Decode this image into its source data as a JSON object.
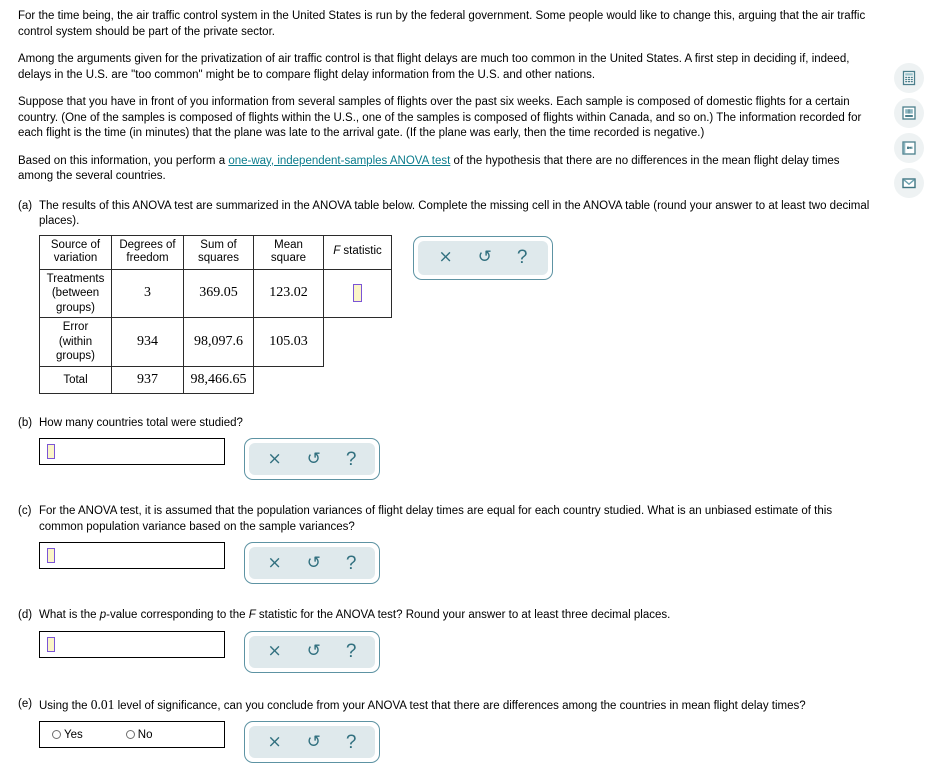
{
  "intro": {
    "p1": "For the time being, the air traffic control system in the United States is run by the federal government. Some people would like to change this, arguing that the air traffic control system should be part of the private sector.",
    "p2": "Among the arguments given for the privatization of air traffic control is that flight delays are much too common in the United States. A first step in deciding if, indeed, delays in the U.S. are \"too common\" might be to compare flight delay information from the U.S. and other nations.",
    "p3": "Suppose that you have in front of you information from several samples of flights over the past six weeks. Each sample is composed of domestic flights for a certain country. (One of the samples is composed of flights within the U.S., one of the samples is composed of flights within Canada, and so on.) The information recorded for each flight is the time (in minutes) that the plane was late to the arrival gate. (If the plane was early, then the time recorded is negative.)",
    "p4_before": "Based on this information, you perform a ",
    "p4_link": "one-way, independent-samples ANOVA test",
    "p4_after": " of the hypothesis that there are no differences in the mean flight delay times among the several countries."
  },
  "parts": {
    "a": {
      "label": "(a)",
      "text": "The results of this ANOVA test are summarized in the ANOVA table below. Complete the missing cell in the ANOVA table (round your answer to at least two decimal places)."
    },
    "b": {
      "label": "(b)",
      "text": "How many countries total were studied?",
      "input_value": ""
    },
    "c": {
      "label": "(c)",
      "text": "For the ANOVA test, it is assumed that the population variances of flight delay times are equal for each country studied. What is an unbiased estimate of this common population variance based on the sample variances?",
      "input_value": ""
    },
    "d": {
      "label": "(d)",
      "text_1": "What is the ",
      "text_italic_p": "p",
      "text_2": "-value corresponding to the ",
      "text_italic_F": "F",
      "text_3": " statistic for the ANOVA test? Round your answer to at least three decimal places.",
      "input_value": ""
    },
    "e": {
      "label": "(e)",
      "text_1": "Using the ",
      "alpha": "0.01",
      "text_2": " level of significance, can you conclude from your ANOVA test that there are differences among the countries in mean flight delay times?",
      "options": [
        "Yes",
        "No"
      ]
    }
  },
  "anova_table": {
    "headers": [
      "Source of variation",
      "Degrees of freedom",
      "Sum of squares",
      "Mean square",
      "F statistic"
    ],
    "header_f_italic": "F",
    "header_f_rest": " statistic",
    "rows": [
      {
        "source": "Treatments (between groups)",
        "source_lines": [
          "Treatments",
          "(between",
          "groups)"
        ],
        "df": "3",
        "ss": "369.05",
        "ms": "123.02",
        "f": ""
      },
      {
        "source": "Error (within groups)",
        "source_lines": [
          "Error",
          "(within",
          "groups)"
        ],
        "df": "934",
        "ss": "98,097.6",
        "ms": "105.03",
        "f": ""
      },
      {
        "source": "Total",
        "source_lines": [
          "Total"
        ],
        "df": "937",
        "ss": "98,466.65",
        "ms": "",
        "f": ""
      }
    ]
  },
  "toolbar": {
    "clear_label": "×",
    "undo_label": "↺",
    "help_label": "?"
  },
  "rail": {
    "items": [
      {
        "name": "calculator-icon"
      },
      {
        "name": "book-icon"
      },
      {
        "name": "glossary-icon"
      },
      {
        "name": "message-icon"
      }
    ]
  },
  "colors": {
    "link": "#0b7c8c",
    "tool_border": "#5d93a3",
    "tool_fill": "#dfe9ec",
    "tool_glyph": "#31707f",
    "caret_border": "#7b55d6",
    "caret_fill": "#fbf5c8",
    "rail_bg": "#eef2f3"
  }
}
